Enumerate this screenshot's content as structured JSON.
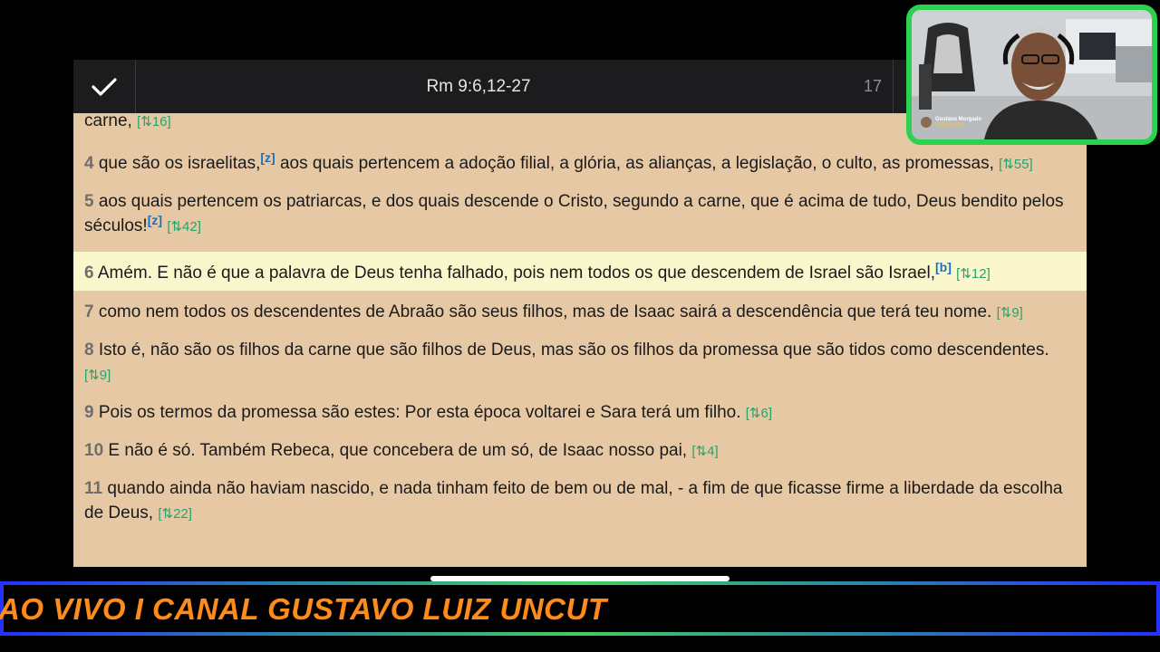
{
  "toolbar": {
    "reference": "Rm 9:6,12-27",
    "count": "17"
  },
  "verses": [
    {
      "text": "carne,",
      "xref": "[⇅16]"
    },
    {
      "num": "4",
      "text": "que são os israelitas,",
      "fn": "[z]",
      "text2": " aos quais pertencem a adoção filial, a glória, as alianças, a legislação, o culto, as promessas,",
      "xref": "[⇅55]"
    },
    {
      "num": "5",
      "text": "aos quais pertencem os patriarcas, e dos quais descende o Cristo, segundo a carne, que é acima de tudo, Deus bendito pelos séculos!",
      "fn": "[z]",
      "xref": "[⇅42]"
    },
    {
      "num": "6",
      "text": "Amém. E não é que a palavra de Deus tenha falhado, pois nem todos os que descendem de Israel são Israel,",
      "fn": "[b]",
      "xref": "[⇅12]"
    },
    {
      "num": "7",
      "text": "como nem todos os descendentes de Abraão são seus filhos, mas de Isaac sairá a descendência que terá teu nome.",
      "xref": "[⇅9]"
    },
    {
      "num": "8",
      "text": "Isto é, não são os filhos da carne que são filhos de Deus, mas são os filhos da promessa que são tidos como descendentes.",
      "xref": "[⇅9]"
    },
    {
      "num": "9",
      "text": "Pois os termos da promessa são estes: Por esta época voltarei e Sara terá um filho.",
      "xref": "[⇅6]"
    },
    {
      "num": "10",
      "text": "E não é só. Também Rebeca, que concebera de um só, de Isaac nosso pai,",
      "xref": "[⇅4]"
    },
    {
      "num": "11",
      "text": "quando ainda não haviam nascido, e nada tinham feito de bem ou de mal, - a fim de que ficasse firme a liberdade da escolha de Deus,",
      "xref": "[⇅22]"
    }
  ],
  "icons": {
    "check": "check-icon",
    "bible": "bible-icon",
    "parallel": "parallel-view-icon",
    "share": "share-icon"
  },
  "colors": {
    "reader_bg": "#e6c9a4",
    "highlight": "#fbf7cc",
    "xref": "#27a36b",
    "footnote": "#1a6fc0",
    "banner_text": "#ff8c1a",
    "cam_border": "#2bd14f"
  },
  "banner": {
    "text": "AO VIVO I CANAL GUSTAVO LUIZ UNCUT"
  },
  "webcam": {
    "name": "Gustavo Morgado",
    "handle": "@4usaflorida"
  }
}
